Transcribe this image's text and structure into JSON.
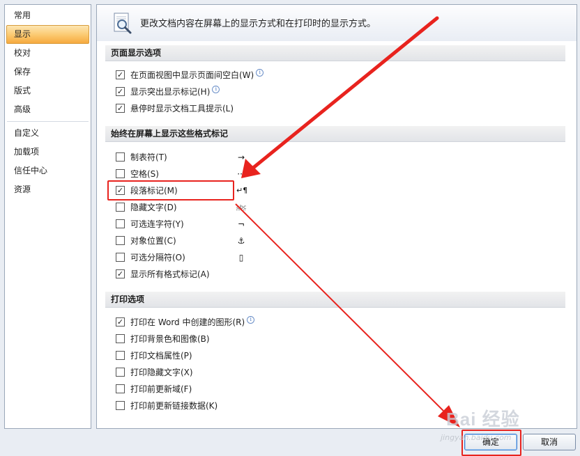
{
  "sidebar": {
    "items": [
      {
        "label": "常用"
      },
      {
        "label": "显示"
      },
      {
        "label": "校对"
      },
      {
        "label": "保存"
      },
      {
        "label": "版式"
      },
      {
        "label": "高级"
      },
      {
        "label": "自定义"
      },
      {
        "label": "加载项"
      },
      {
        "label": "信任中心"
      },
      {
        "label": "资源"
      }
    ],
    "selected": "显示"
  },
  "header": {
    "description": "更改文档内容在屏幕上的显示方式和在打印时的显示方式。",
    "icon": "magnifier-document-icon"
  },
  "sections": {
    "page_display": {
      "title": "页面显示选项",
      "options": [
        {
          "label": "在页面视图中显示页面间空白(W)",
          "checked": true,
          "info": true
        },
        {
          "label": "显示突出显示标记(H)",
          "checked": true,
          "info": true
        },
        {
          "label": "悬停时显示文档工具提示(L)",
          "checked": true,
          "info": false
        }
      ]
    },
    "format_marks": {
      "title": "始终在屏幕上显示这些格式标记",
      "options": [
        {
          "label": "制表符(T)",
          "checked": false,
          "mark": "→"
        },
        {
          "label": "空格(S)",
          "checked": false,
          "mark": "···"
        },
        {
          "label": "段落标记(M)",
          "checked": true,
          "mark": "↵¶"
        },
        {
          "label": "隐藏文字(D)",
          "checked": false,
          "mark": "abc"
        },
        {
          "label": "可选连字符(Y)",
          "checked": false,
          "mark": "¬"
        },
        {
          "label": "对象位置(C)",
          "checked": false,
          "mark": "⚓"
        },
        {
          "label": "可选分隔符(O)",
          "checked": false,
          "mark": "▯"
        },
        {
          "label": "显示所有格式标记(A)",
          "checked": true,
          "mark": ""
        }
      ]
    },
    "print": {
      "title": "打印选项",
      "options": [
        {
          "label": "打印在 Word 中创建的图形(R)",
          "checked": true,
          "info": true
        },
        {
          "label": "打印背景色和图像(B)",
          "checked": false,
          "info": false
        },
        {
          "label": "打印文档属性(P)",
          "checked": false,
          "info": false
        },
        {
          "label": "打印隐藏文字(X)",
          "checked": false,
          "info": false
        },
        {
          "label": "打印前更新域(F)",
          "checked": false,
          "info": false
        },
        {
          "label": "打印前更新链接数据(K)",
          "checked": false,
          "info": false
        }
      ]
    }
  },
  "buttons": {
    "ok": "确定",
    "cancel": "取消"
  },
  "watermark": {
    "brand": "Bai 经验",
    "url": "jingyan.baidu.com"
  },
  "colors": {
    "annotation": "#e8231e",
    "selected_nav": "#fbc86e"
  }
}
